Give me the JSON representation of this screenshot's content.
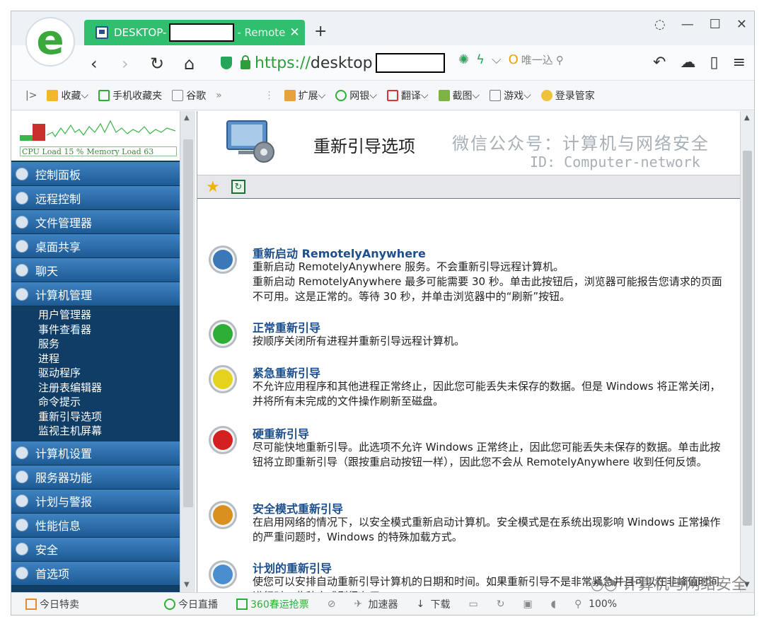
{
  "browser": {
    "tab": {
      "title_prefix": "DESKTOP-",
      "title_suffix": "- Remote"
    },
    "url": {
      "scheme": "https://",
      "host_prefix": "desktop"
    },
    "search": {
      "placeholder": "唯一込"
    },
    "bookmarks": [
      {
        "label": "收藏",
        "icon": "star-folder-icon"
      },
      {
        "label": "手机收藏夹",
        "icon": "phone-icon"
      },
      {
        "label": "谷歌",
        "icon": "page-icon"
      },
      {
        "label": "»",
        "icon": ""
      },
      {
        "label": "扩展",
        "icon": "grid-icon"
      },
      {
        "label": "网银",
        "icon": "bank-icon"
      },
      {
        "label": "翻译",
        "icon": "translate-icon"
      },
      {
        "label": "截图",
        "icon": "scissors-icon"
      },
      {
        "label": "游戏",
        "icon": "gamepad-icon"
      },
      {
        "label": "登录管家",
        "icon": "key-icon"
      }
    ],
    "statusbar": [
      {
        "label": "今日特卖",
        "icon": "gift-icon"
      },
      {
        "label": "今日直播",
        "icon": "play-icon"
      },
      {
        "label": "360春运抢票",
        "icon": "phone-icon"
      },
      {
        "label": "加速器",
        "icon": "rocket-icon"
      },
      {
        "label": "下载",
        "icon": "download-icon"
      },
      {
        "label": "100%",
        "icon": "zoom-icon"
      }
    ]
  },
  "monitor": {
    "cpu_label": "CPU Load 15 %",
    "mem_label": "Memory Load 63"
  },
  "sidebar": {
    "items_top": [
      {
        "label": "控制面板"
      },
      {
        "label": "远程控制"
      },
      {
        "label": "文件管理器"
      },
      {
        "label": "桌面共享"
      },
      {
        "label": "聊天"
      },
      {
        "label": "计算机管理"
      }
    ],
    "subitems": [
      "用户管理器",
      "事件查看器",
      "服务",
      "进程",
      "驱动程序",
      "注册表编辑器",
      "命令提示",
      "重新引导选项",
      "监视主机屏幕"
    ],
    "items_bottom": [
      {
        "label": "计算机设置"
      },
      {
        "label": "服务器功能"
      },
      {
        "label": "计划与警报"
      },
      {
        "label": "性能信息"
      },
      {
        "label": "安全"
      },
      {
        "label": "首选项"
      }
    ]
  },
  "page": {
    "title": "重新引导选项",
    "watermark_line1": "微信公众号：计算机与网络安全",
    "watermark_line2": "ID: Computer-network"
  },
  "options": [
    {
      "title": "重新启动 RemotelyAnywhere",
      "desc": "重新启动 RemotelyAnywhere 服务。不会重新引导远程计算机。\n重新启动 RemotelyAnywhere 最多可能需要 30 秒。单击此按钮后，浏览器可能报告您请求的页面不可用。这是正常的。等待 30 秒，并单击浏览器中的“刷新”按钮。",
      "color": "#3b78b8"
    },
    {
      "title": "正常重新引导",
      "desc": "按顺序关闭所有进程并重新引导远程计算机。",
      "color": "#2fae37"
    },
    {
      "title": "紧急重新引导",
      "desc": "不允许应用程序和其他进程正常终止，因此您可能丢失未保存的数据。但是 Windows 将正常关闭，并将所有未完成的文件操作刷新至磁盘。",
      "color": "#e4d21e"
    },
    {
      "title": "硬重新引导",
      "desc": "尽可能快地重新引导。此选项不允许 Windows 正常终止，因此您可能丢失未保存的数据。单击此按钮将立即重新引导（跟按重启动按钮一样），因此您不会从 RemotelyAnywhere 收到任何反馈。",
      "color": "#d42020"
    },
    {
      "title": "安全模式重新引导",
      "desc": "在启用网络的情况下，以安全模式重新启动计算机。安全模式是在系统出现影响 Windows 正常操作的严重问题时，Windows 的特殊加载方式。",
      "color": "#d9901e"
    },
    {
      "title": "计划的重新引导",
      "desc": "使您可以安排自动重新引导计算机的日期和时间。如果重新引导不是非常紧急并且可以在非峰值时间进行时，此种方式则很有用。",
      "color": "#4a8ed0"
    }
  ],
  "overlay": {
    "wechat": "计算机与网络安全"
  }
}
